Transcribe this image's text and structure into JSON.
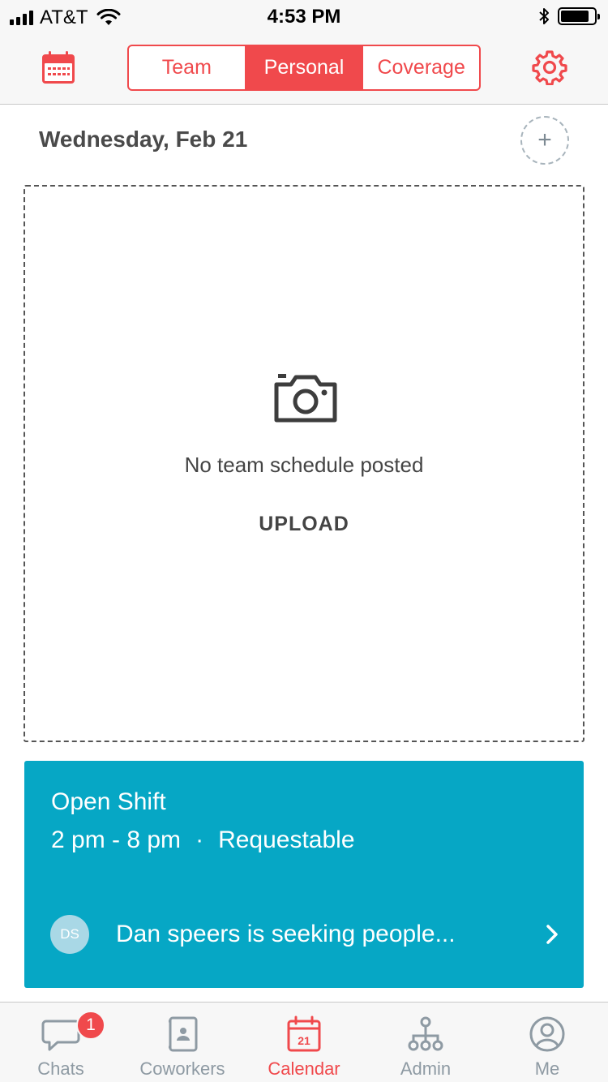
{
  "status_bar": {
    "carrier": "AT&T",
    "time": "4:53 PM",
    "battery_level": 0.85
  },
  "nav": {
    "segments": [
      "Team",
      "Personal",
      "Coverage"
    ],
    "active_segment": "Personal",
    "left_icon": "calendar-icon",
    "right_icon": "gear-icon"
  },
  "date_header": {
    "title": "Wednesday, Feb 21",
    "add_symbol": "+"
  },
  "schedule": {
    "empty_message": "No team schedule posted",
    "upload_label": "UPLOAD",
    "icon": "camera-icon"
  },
  "open_shift": {
    "title": "Open Shift",
    "time_range": "2 pm - 8 pm",
    "separator": "·",
    "status": "Requestable",
    "avatar_initials": "DS",
    "message": "Dan speers is seeking people..."
  },
  "tabbar": {
    "items": [
      {
        "label": "Chats",
        "icon": "chat-bubble-icon",
        "badge": "1"
      },
      {
        "label": "Coworkers",
        "icon": "contacts-book-icon"
      },
      {
        "label": "Calendar",
        "icon": "calendar-day-icon",
        "icon_text": "21",
        "active": true
      },
      {
        "label": "Admin",
        "icon": "org-chart-icon"
      },
      {
        "label": "Me",
        "icon": "user-circle-icon"
      }
    ]
  },
  "colors": {
    "accent": "#f0494c",
    "card": "#06a7c5",
    "inactive": "#8e9aa3"
  }
}
